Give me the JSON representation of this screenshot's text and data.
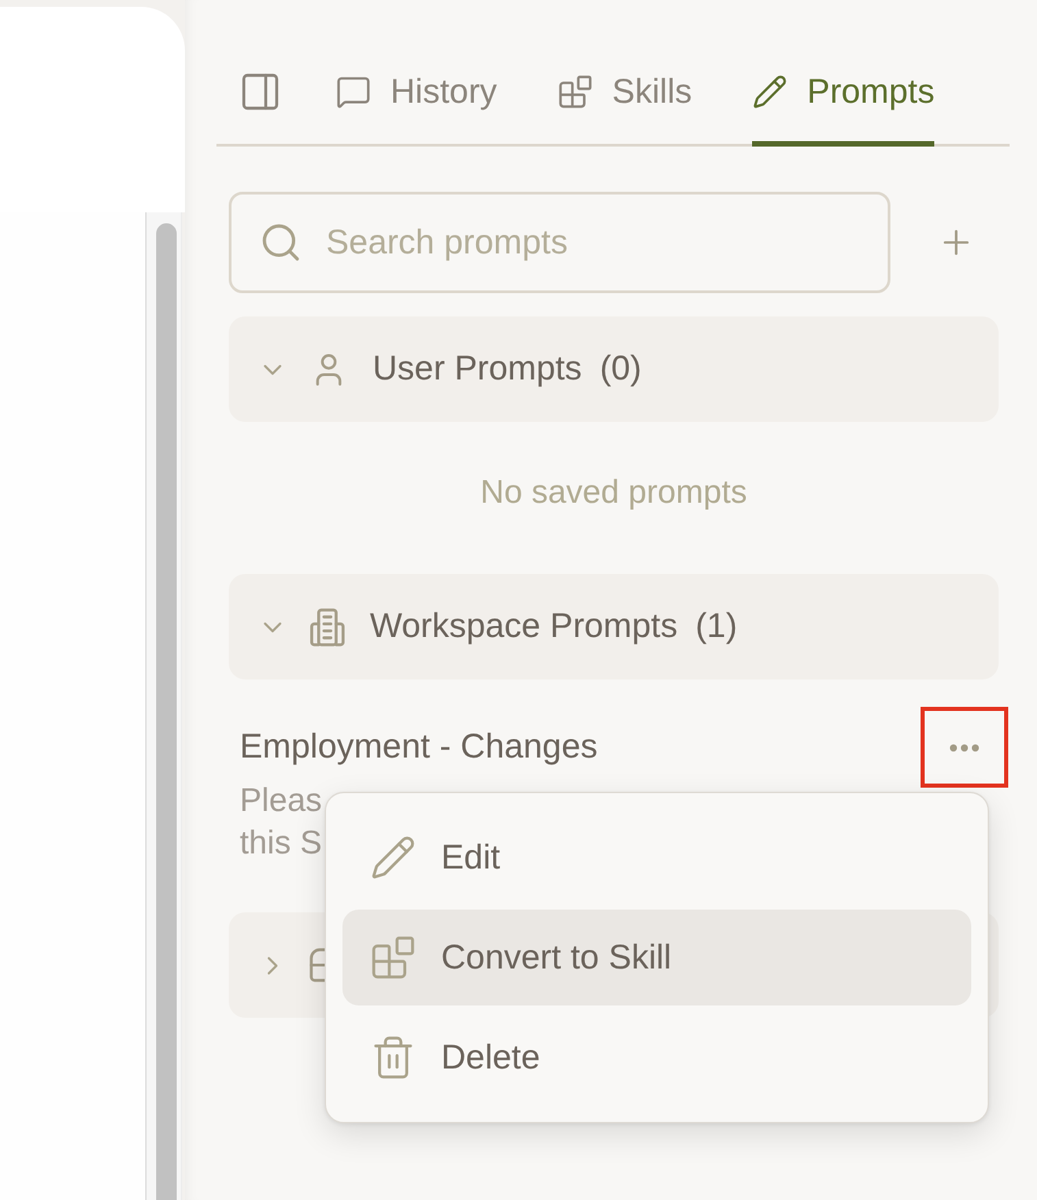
{
  "tabs": [
    {
      "label": "History",
      "selected": false
    },
    {
      "label": "Skills",
      "selected": false
    },
    {
      "label": "Prompts",
      "selected": true
    }
  ],
  "search": {
    "placeholder": "Search prompts"
  },
  "sections": [
    {
      "title": "User Prompts",
      "count": "(0)",
      "expanded": true,
      "empty_text": "No saved prompts"
    },
    {
      "title": "Workspace Prompts",
      "count": "(1)",
      "expanded": true,
      "prompts": [
        {
          "title": "Employment - Changes",
          "description_lines": [
            "Pleas",
            "this S"
          ],
          "more_highlighted": true,
          "menu": {
            "items": [
              {
                "label": "Edit",
                "selected": false
              },
              {
                "label": "Convert to Skill",
                "selected": true
              },
              {
                "label": "Delete",
                "selected": false
              }
            ]
          }
        }
      ]
    },
    {
      "expanded": false
    }
  ]
}
